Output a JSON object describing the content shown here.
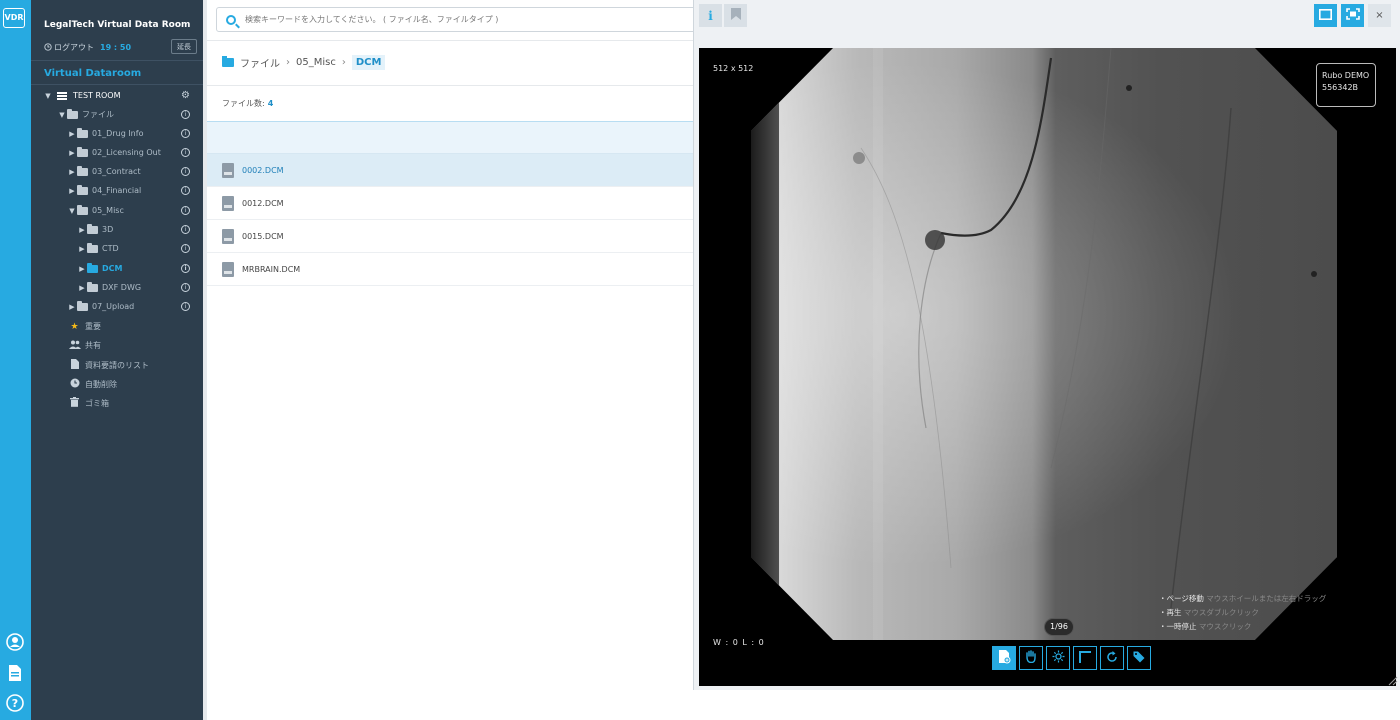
{
  "rail": {
    "logo": "VDR",
    "icons": [
      "user-circle-icon",
      "document-icon",
      "help-icon"
    ]
  },
  "sidebar": {
    "brand": "LegalTech Virtual Data Room",
    "logout_label": "ログアウト",
    "logout_time": "19 : 50",
    "extend_label": "延長",
    "section_title": "Virtual Dataroom",
    "room_name": "TEST ROOM",
    "tree": [
      {
        "label": "ファイル"
      },
      {
        "label": "01_Drug Info"
      },
      {
        "label": "02_Licensing Out"
      },
      {
        "label": "03_Contract"
      },
      {
        "label": "04_Financial"
      },
      {
        "label": "05_Misc"
      },
      {
        "label": "3D"
      },
      {
        "label": "CTD"
      },
      {
        "label": "DCM"
      },
      {
        "label": "DXF DWG"
      },
      {
        "label": "07_Upload"
      }
    ],
    "shortcuts": [
      {
        "label": "重要",
        "icon": "star-icon"
      },
      {
        "label": "共有",
        "icon": "users-icon"
      },
      {
        "label": "資料要請のリスト",
        "icon": "document-icon"
      },
      {
        "label": "自動削除",
        "icon": "clock-icon"
      },
      {
        "label": "ゴミ箱",
        "icon": "trash-icon"
      }
    ]
  },
  "main": {
    "search_placeholder": "検索キーワードを入力してください。 ( ファイル名、ファイルタイプ )",
    "breadcrumb": [
      "ファイル",
      "05_Misc",
      "DCM"
    ],
    "file_count_label": "ファイル数:",
    "file_count": "4",
    "files": [
      {
        "name": "0002.DCM",
        "selected": true
      },
      {
        "name": "0012.DCM",
        "selected": false
      },
      {
        "name": "0015.DCM",
        "selected": false
      },
      {
        "name": "MRBRAIN.DCM",
        "selected": false
      }
    ]
  },
  "viewer": {
    "info_label": "i",
    "close_label": "×",
    "dims": "512 x 512",
    "demo_line1": "Rubo DEMO",
    "demo_line2": "556342B",
    "wl": "W : 0 L : 0",
    "page_indicator": "1/96",
    "hints": [
      {
        "label": "・ページ移動",
        "sub": "マウスホイールまたは左右ドラッグ"
      },
      {
        "label": "・再生",
        "sub": "マウスダブルクリック"
      },
      {
        "label": "・一時停止",
        "sub": "マウスクリック"
      }
    ],
    "tools": [
      "add-page-icon",
      "hand-icon",
      "brightness-icon",
      "crop-icon",
      "rotate-icon",
      "tag-icon"
    ]
  },
  "colors": {
    "accent": "#27aae1",
    "sidebar_bg": "#2d3e4d",
    "selected_row": "#dcecf6"
  }
}
